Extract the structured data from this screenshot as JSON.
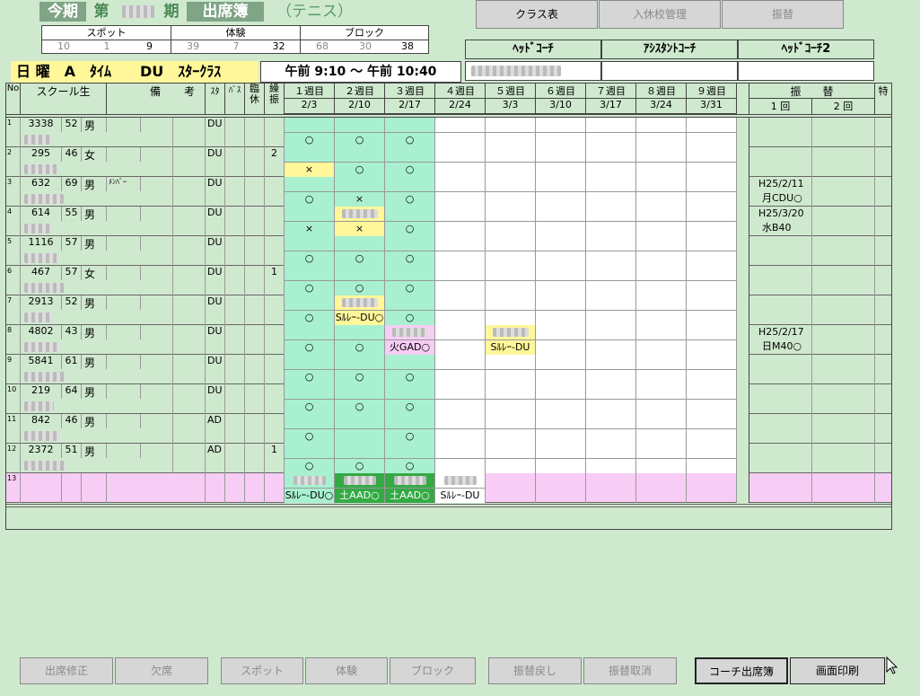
{
  "header": {
    "term_now": "今期",
    "term_prefix": "第",
    "term_suffix": "期",
    "screen_title": "出席簿",
    "category": "（テニス）"
  },
  "stats": {
    "headers": [
      "スポット",
      "体験",
      "ブロック"
    ],
    "values": [
      "10",
      "1",
      "9",
      "39",
      "7",
      "32",
      "68",
      "30",
      "38"
    ]
  },
  "top_buttons": [
    "クラス表",
    "入休校管理",
    "振替"
  ],
  "coaches": {
    "labels": [
      "ﾍｯﾄﾞｺｰﾁ",
      "ｱｼｽﾀﾝﾄｺｰﾁ",
      "ﾍｯﾄﾞｺｰﾁ2"
    ]
  },
  "class_info": {
    "name": "日 曜　A　ﾀｲﾑ　　DU　ｽﾀｰｸﾗｽ",
    "time": "午前 9:10 ～ 午前 10:40"
  },
  "columns": {
    "no": "No",
    "student": "スクール生",
    "remarks1": "備",
    "remarks2": "考",
    "status": "ｽﾀ",
    "bus": "ﾊﾞｽ",
    "temp_rest": "臨休",
    "carry1": "繰",
    "carry2": "振",
    "makeup": "振　　替",
    "makeup1": "1 回",
    "makeup2": "2 回",
    "special": "特"
  },
  "weeks": [
    {
      "label": "１週目",
      "date": "2/3"
    },
    {
      "label": "２週目",
      "date": "2/10"
    },
    {
      "label": "３週目",
      "date": "2/17"
    },
    {
      "label": "４週目",
      "date": "2/24"
    },
    {
      "label": "５週目",
      "date": "3/3"
    },
    {
      "label": "６週目",
      "date": "3/10"
    },
    {
      "label": "７週目",
      "date": "3/17"
    },
    {
      "label": "８週目",
      "date": "3/24"
    },
    {
      "label": "９週目",
      "date": "3/31"
    }
  ],
  "students": [
    {
      "no": "1",
      "id": "3338",
      "age": "52",
      "sex": "男",
      "remark": "",
      "status": "DU",
      "carry": "",
      "marks": [
        "○",
        "○",
        "○"
      ],
      "top": [
        "",
        "",
        ""
      ],
      "makeup1a": "",
      "makeup1b": ""
    },
    {
      "no": "2",
      "id": "295",
      "age": "46",
      "sex": "女",
      "remark": "",
      "status": "DU",
      "carry": "2",
      "marks": [
        "×",
        "○",
        "○"
      ],
      "top": [
        "",
        "",
        ""
      ],
      "makeup1a": "",
      "makeup1b": ""
    },
    {
      "no": "3",
      "id": "632",
      "age": "69",
      "sex": "男",
      "remark": "ﾒﾝﾊﾞｰ",
      "status": "DU",
      "carry": "",
      "marks": [
        "○",
        "×",
        "○"
      ],
      "top": [
        "",
        "",
        ""
      ],
      "makeup1a": "H25/2/11",
      "makeup1b": "月CDU○"
    },
    {
      "no": "4",
      "id": "614",
      "age": "55",
      "sex": "男",
      "remark": "",
      "status": "DU",
      "carry": "",
      "marks": [
        "×",
        "×",
        "○"
      ],
      "top": [
        "",
        "",
        ""
      ],
      "makeup1a": "H25/3/20",
      "makeup1b": "水B40"
    },
    {
      "no": "5",
      "id": "1116",
      "age": "57",
      "sex": "男",
      "remark": "",
      "status": "DU",
      "carry": "",
      "marks": [
        "○",
        "○",
        "○"
      ],
      "top": [
        "",
        "",
        ""
      ],
      "makeup1a": "",
      "makeup1b": ""
    },
    {
      "no": "6",
      "id": "467",
      "age": "57",
      "sex": "女",
      "remark": "",
      "status": "DU",
      "carry": "1",
      "marks": [
        "○",
        "○",
        "○"
      ],
      "top": [
        "",
        "",
        ""
      ],
      "makeup1a": "",
      "makeup1b": ""
    },
    {
      "no": "7",
      "id": "2913",
      "age": "52",
      "sex": "男",
      "remark": "",
      "status": "DU",
      "carry": "",
      "marks": [
        "○",
        "Sﾙﾚｰ-DU○",
        "○"
      ],
      "top": [
        "",
        "",
        ""
      ],
      "makeup1a": "",
      "makeup1b": ""
    },
    {
      "no": "8",
      "id": "4802",
      "age": "43",
      "sex": "男",
      "remark": "",
      "status": "DU",
      "carry": "",
      "marks": [
        "○",
        "○",
        "火GAD○"
      ],
      "top": [
        "",
        "",
        ""
      ],
      "w5": "Sﾙﾚｰ-DU",
      "makeup1a": "H25/2/17",
      "makeup1b": "日M40○"
    },
    {
      "no": "9",
      "id": "5841",
      "age": "61",
      "sex": "男",
      "remark": "",
      "status": "DU",
      "carry": "",
      "marks": [
        "○",
        "○",
        "○"
      ],
      "top": [
        "",
        "",
        ""
      ],
      "makeup1a": "",
      "makeup1b": ""
    },
    {
      "no": "10",
      "id": "219",
      "age": "64",
      "sex": "男",
      "remark": "",
      "status": "DU",
      "carry": "",
      "marks": [
        "○",
        "○",
        "○"
      ],
      "top": [
        "",
        "",
        ""
      ],
      "makeup1a": "",
      "makeup1b": ""
    },
    {
      "no": "11",
      "id": "842",
      "age": "46",
      "sex": "男",
      "remark": "",
      "status": "AD",
      "carry": "",
      "marks": [
        "○",
        "",
        "○"
      ],
      "top": [
        "",
        "",
        ""
      ],
      "makeup1a": "",
      "makeup1b": ""
    },
    {
      "no": "12",
      "id": "2372",
      "age": "51",
      "sex": "男",
      "remark": "",
      "status": "AD",
      "carry": "1",
      "marks": [
        "○",
        "○",
        "○"
      ],
      "top": [
        "",
        "",
        ""
      ],
      "makeup1a": "",
      "makeup1b": ""
    }
  ],
  "row13": {
    "no": "13",
    "w1": "Sﾙﾚｰ-DU○",
    "w2": "土AAD○",
    "w3": "土AAD○",
    "w4": "Sﾙﾚｰ-DU"
  },
  "bottom_buttons": [
    "出席修正",
    "欠席",
    "スポット",
    "体験",
    "ブロック",
    "振替戻し",
    "振替取消",
    "コーチ出席簿",
    "画面印刷"
  ],
  "colors": {
    "week_green": "#a8f0d0",
    "yellow": "#fff79a",
    "pink": "#f7cdf5",
    "dark_green": "#33aa44",
    "bg": "#cfe9cf"
  }
}
